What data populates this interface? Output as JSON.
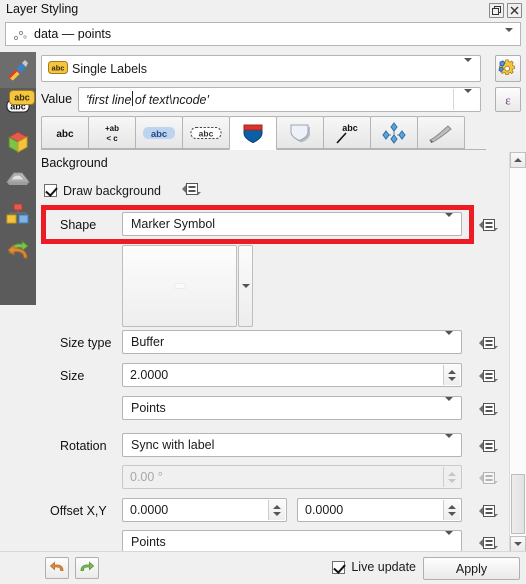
{
  "window": {
    "title": "Layer Styling",
    "buttons": [
      {
        "name": "float-button",
        "icon": "float-icon"
      },
      {
        "name": "close-button",
        "icon": "close-icon"
      }
    ]
  },
  "layer_selector": {
    "value": "data — points",
    "icon": "point-layer-icon"
  },
  "rail": {
    "items": [
      {
        "icon": "labels-abc-icon",
        "selected": false
      },
      {
        "icon": "three-d-cube-icon",
        "selected": false
      },
      {
        "icon": "masks-icon",
        "selected": false
      },
      {
        "icon": "diagrams-icon",
        "selected": false
      },
      {
        "icon": "actions-arrows-icon",
        "selected": false
      }
    ]
  },
  "style_type": {
    "value": "Single Labels",
    "icon": "abc-yellow-icon",
    "options_button": "labeling-options-button"
  },
  "value_row": {
    "label": "Value",
    "icon": "abc-yellow-icon",
    "value": "'first line of text\\ncode'",
    "expression_button": "epsilon-expression-button"
  },
  "tabs": [
    {
      "label": "Text",
      "icon": "abc-text-icon",
      "selected": false
    },
    {
      "label": "Formatting",
      "icon": "abc-formatting-icon",
      "selected": false
    },
    {
      "label": "Buffer",
      "icon": "abc-buffer-icon",
      "selected": false
    },
    {
      "label": "Mask",
      "icon": "abc-mask-icon",
      "selected": false
    },
    {
      "label": "Background",
      "icon": "shield-background-icon",
      "selected": true
    },
    {
      "label": "Shadow",
      "icon": "shield-shadow-icon",
      "selected": false
    },
    {
      "label": "Callouts",
      "icon": "abc-callout-icon",
      "selected": false
    },
    {
      "label": "Placement",
      "icon": "placement-diamond-icon",
      "selected": false
    },
    {
      "label": "Rendering",
      "icon": "brush-rendering-icon",
      "selected": false
    }
  ],
  "background": {
    "section_title": "Background",
    "draw_background": {
      "label": "Draw background",
      "checked": true
    },
    "shape": {
      "label": "Shape",
      "value": "Marker Symbol",
      "highlighted": true
    },
    "symbol_preview": {
      "name": "symbol-preview"
    },
    "size_type": {
      "label": "Size type",
      "value": "Buffer"
    },
    "size": {
      "label": "Size",
      "value": "2.0000"
    },
    "size_unit": {
      "value": "Points"
    },
    "rotation": {
      "label": "Rotation",
      "value": "Sync with label"
    },
    "rotation_angle": {
      "value": "0.00 °",
      "disabled": true
    },
    "offset": {
      "label": "Offset X,Y",
      "x": "0.0000",
      "y": "0.0000"
    },
    "offset_unit": {
      "value": "Points"
    }
  },
  "footer": {
    "undo_button": "undo-icon",
    "redo_button": "redo-icon",
    "live_update": {
      "label": "Live update",
      "checked": true
    },
    "apply_label": "Apply"
  },
  "colors": {
    "highlight": "#ed1c24",
    "panel_bg": "#f0f0f0",
    "rail_bg": "#5b5b5b"
  }
}
